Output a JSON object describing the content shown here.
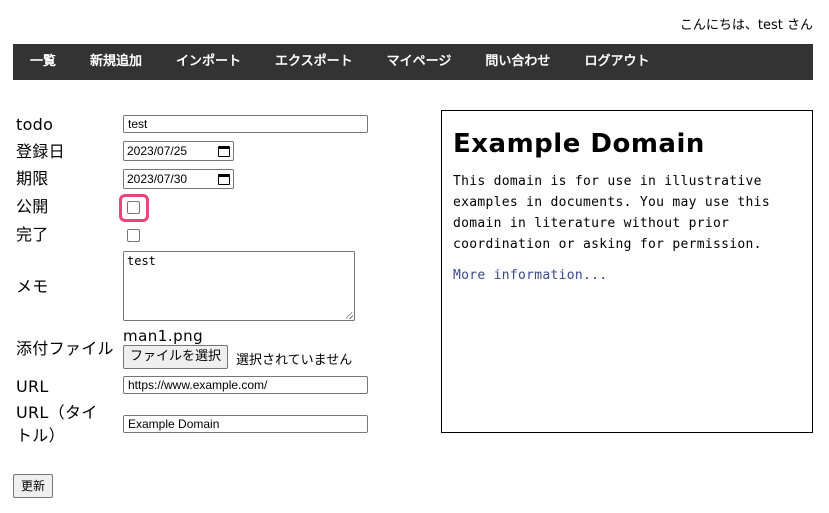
{
  "header": {
    "greeting": "こんにちは、test さん"
  },
  "nav": {
    "items": [
      {
        "label": "一覧"
      },
      {
        "label": "新規追加"
      },
      {
        "label": "インポート"
      },
      {
        "label": "エクスポート"
      },
      {
        "label": "マイページ"
      },
      {
        "label": "問い合わせ"
      },
      {
        "label": "ログアウト"
      }
    ]
  },
  "form": {
    "todo": {
      "label": "todo",
      "value": "test"
    },
    "registered": {
      "label": "登録日",
      "value": "2023/07/25"
    },
    "deadline": {
      "label": "期限",
      "value": "2023/07/30"
    },
    "public": {
      "label": "公開",
      "checked": false
    },
    "done": {
      "label": "完了",
      "checked": false
    },
    "memo": {
      "label": "メモ",
      "value": "test"
    },
    "attachment": {
      "label": "添付ファイル",
      "current_file": "man1.png",
      "button_label": "ファイルを選択",
      "status": "選択されていません"
    },
    "url": {
      "label": "URL",
      "value": "https://www.example.com/"
    },
    "url_title": {
      "label_line1": "URL（タイ",
      "label_line2": "トル）",
      "value": "Example Domain"
    },
    "submit_label": "更新"
  },
  "preview": {
    "title": "Example Domain",
    "text": "This domain is for use in illustrative examples in documents. You may use this domain in literature without prior coordination or asking for permission.",
    "link": "More information..."
  },
  "colors": {
    "navbar_bg": "#333333",
    "focus_ring": "#e8457a",
    "link": "#38488f"
  }
}
